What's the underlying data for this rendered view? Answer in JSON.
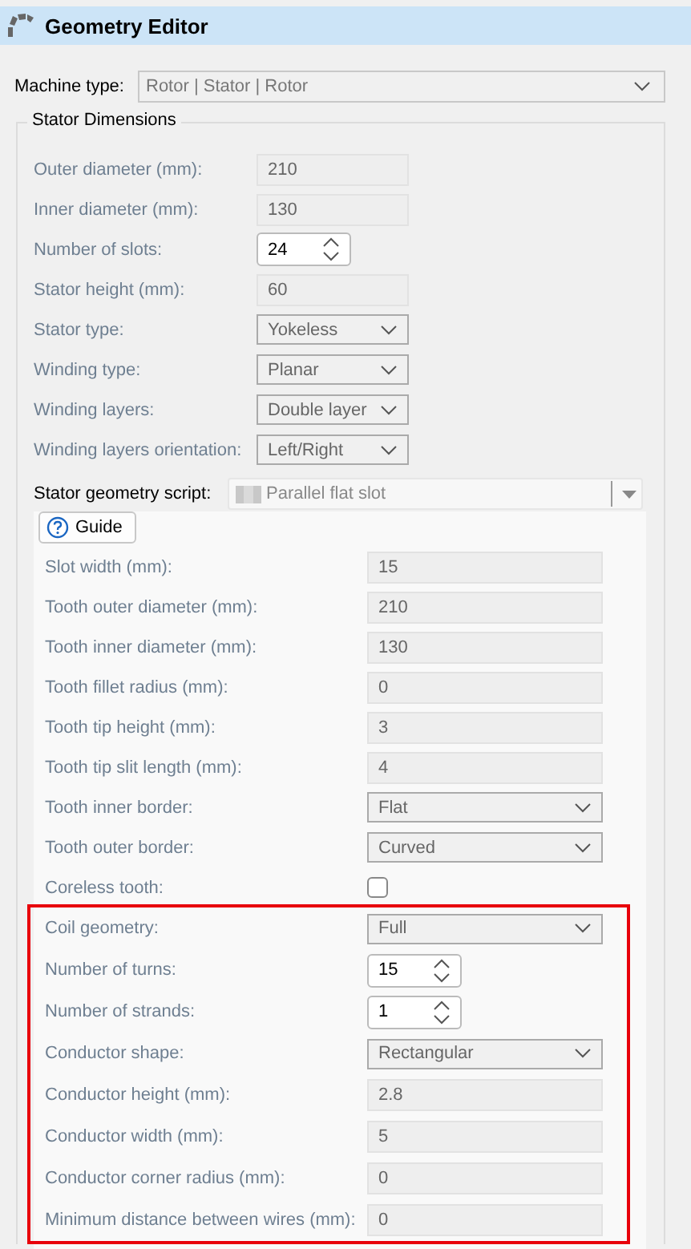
{
  "window": {
    "title": "Geometry Editor"
  },
  "machine_type": {
    "label": "Machine type:",
    "value": "Rotor | Stator | Rotor"
  },
  "stator_dimensions": {
    "title": "Stator Dimensions",
    "rows": [
      {
        "label": "Outer diameter (mm):",
        "kind": "text",
        "value": "210",
        "disabled": true
      },
      {
        "label": "Inner diameter (mm):",
        "kind": "text",
        "value": "130",
        "disabled": true
      },
      {
        "label": "Number of slots:",
        "kind": "spin",
        "value": "24",
        "disabled": true
      },
      {
        "label": "Stator height (mm):",
        "kind": "text",
        "value": "60",
        "disabled": true
      },
      {
        "label": "Stator type:",
        "kind": "combo",
        "value": "Yokeless",
        "disabled": true
      },
      {
        "label": "Winding type:",
        "kind": "combo",
        "value": "Planar",
        "disabled": true
      },
      {
        "label": "Winding layers:",
        "kind": "combo",
        "value": "Double layer",
        "disabled": true
      },
      {
        "label": "Winding layers orientation:",
        "kind": "combo",
        "value": "Left/Right",
        "disabled": true
      }
    ],
    "script": {
      "label": "Stator geometry script:",
      "value": "Parallel flat slot",
      "disabled": false
    },
    "guide_button": "Guide",
    "script_rows": [
      {
        "label": "Slot width (mm):",
        "kind": "text",
        "value": "15",
        "disabled": true
      },
      {
        "label": "Tooth outer diameter (mm):",
        "kind": "text",
        "value": "210",
        "disabled": true
      },
      {
        "label": "Tooth inner diameter (mm):",
        "kind": "text",
        "value": "130",
        "disabled": true
      },
      {
        "label": "Tooth fillet radius (mm):",
        "kind": "text",
        "value": "0",
        "disabled": true
      },
      {
        "label": "Tooth tip height (mm):",
        "kind": "text",
        "value": "3",
        "disabled": true
      },
      {
        "label": "Tooth tip slit length (mm):",
        "kind": "text",
        "value": "4",
        "disabled": true
      },
      {
        "label": "Tooth inner border:",
        "kind": "combo",
        "value": "Flat",
        "disabled": true
      },
      {
        "label": "Tooth outer border:",
        "kind": "combo",
        "value": "Curved",
        "disabled": true
      },
      {
        "label": "Coreless tooth:",
        "kind": "checkbox",
        "checked": false,
        "disabled": true
      }
    ],
    "highlighted_rows": [
      {
        "label": "Coil geometry:",
        "kind": "combo",
        "value": "Full",
        "disabled": true
      },
      {
        "label": "Number of turns:",
        "kind": "spin",
        "value": "15",
        "disabled": true
      },
      {
        "label": "Number of strands:",
        "kind": "spin",
        "value": "1",
        "disabled": true
      },
      {
        "label": "Conductor shape:",
        "kind": "combo",
        "value": "Rectangular",
        "disabled": true
      },
      {
        "label": "Conductor height (mm):",
        "kind": "text",
        "value": "2.8",
        "disabled": true
      },
      {
        "label": "Conductor width (mm):",
        "kind": "text",
        "value": "5",
        "disabled": true
      },
      {
        "label": "Conductor corner radius (mm):",
        "kind": "text",
        "value": "0",
        "disabled": true
      },
      {
        "label": "Minimum distance between wires (mm):",
        "kind": "text",
        "value": "0",
        "disabled": true
      }
    ]
  }
}
